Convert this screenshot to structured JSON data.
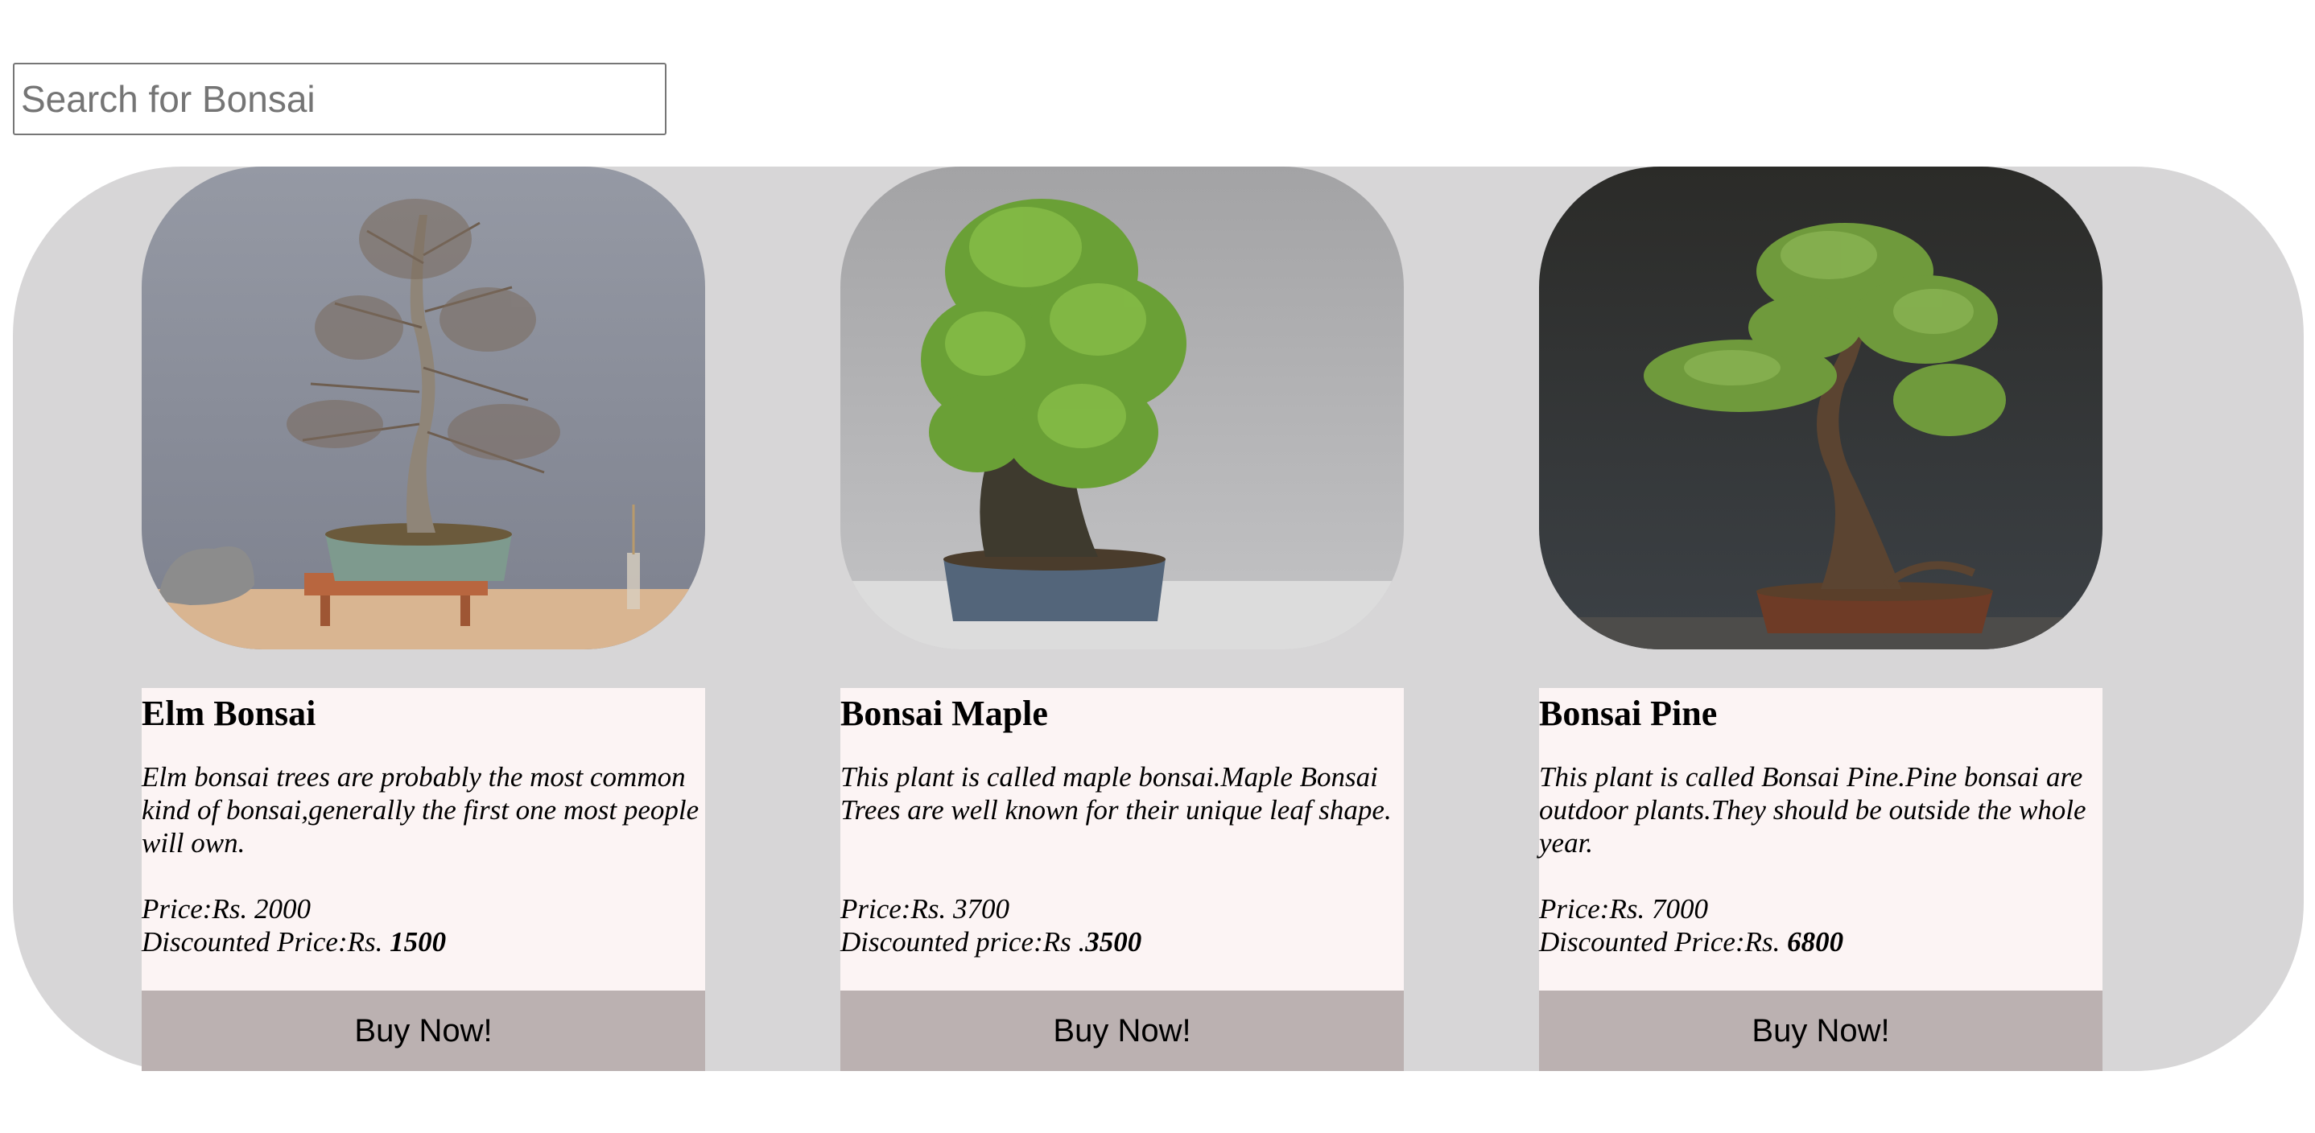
{
  "search": {
    "placeholder": "Search for Bonsai"
  },
  "products": [
    {
      "name": "Elm Bonsai",
      "description": "Elm bonsai trees are probably the most common kind of bonsai,generally the first one most people will own.",
      "price_label": "Price:Rs. 2000",
      "discount_prefix": "Discounted Price:Rs. ",
      "discount_value": "1500",
      "button_label": "Buy Now!"
    },
    {
      "name": "Bonsai Maple",
      "description": "This plant is called maple bonsai.Maple Bonsai Trees are well known for their unique leaf shape.",
      "price_label": "Price:Rs. 3700",
      "discount_prefix": "Discounted price:Rs .",
      "discount_value": "3500",
      "button_label": "Buy Now!"
    },
    {
      "name": "Bonsai Pine",
      "description": "This plant is called Bonsai Pine.Pine bonsai are outdoor plants.They should be outside the whole year.",
      "price_label": "Price:Rs. 7000",
      "discount_prefix": "Discounted Price:Rs. ",
      "discount_value": "6800",
      "button_label": "Buy Now!"
    }
  ],
  "colors": {
    "gallery_bg": "#d7d6d7",
    "card_bg": "#fcf4f4",
    "button_bg": "#bbb1b1"
  }
}
